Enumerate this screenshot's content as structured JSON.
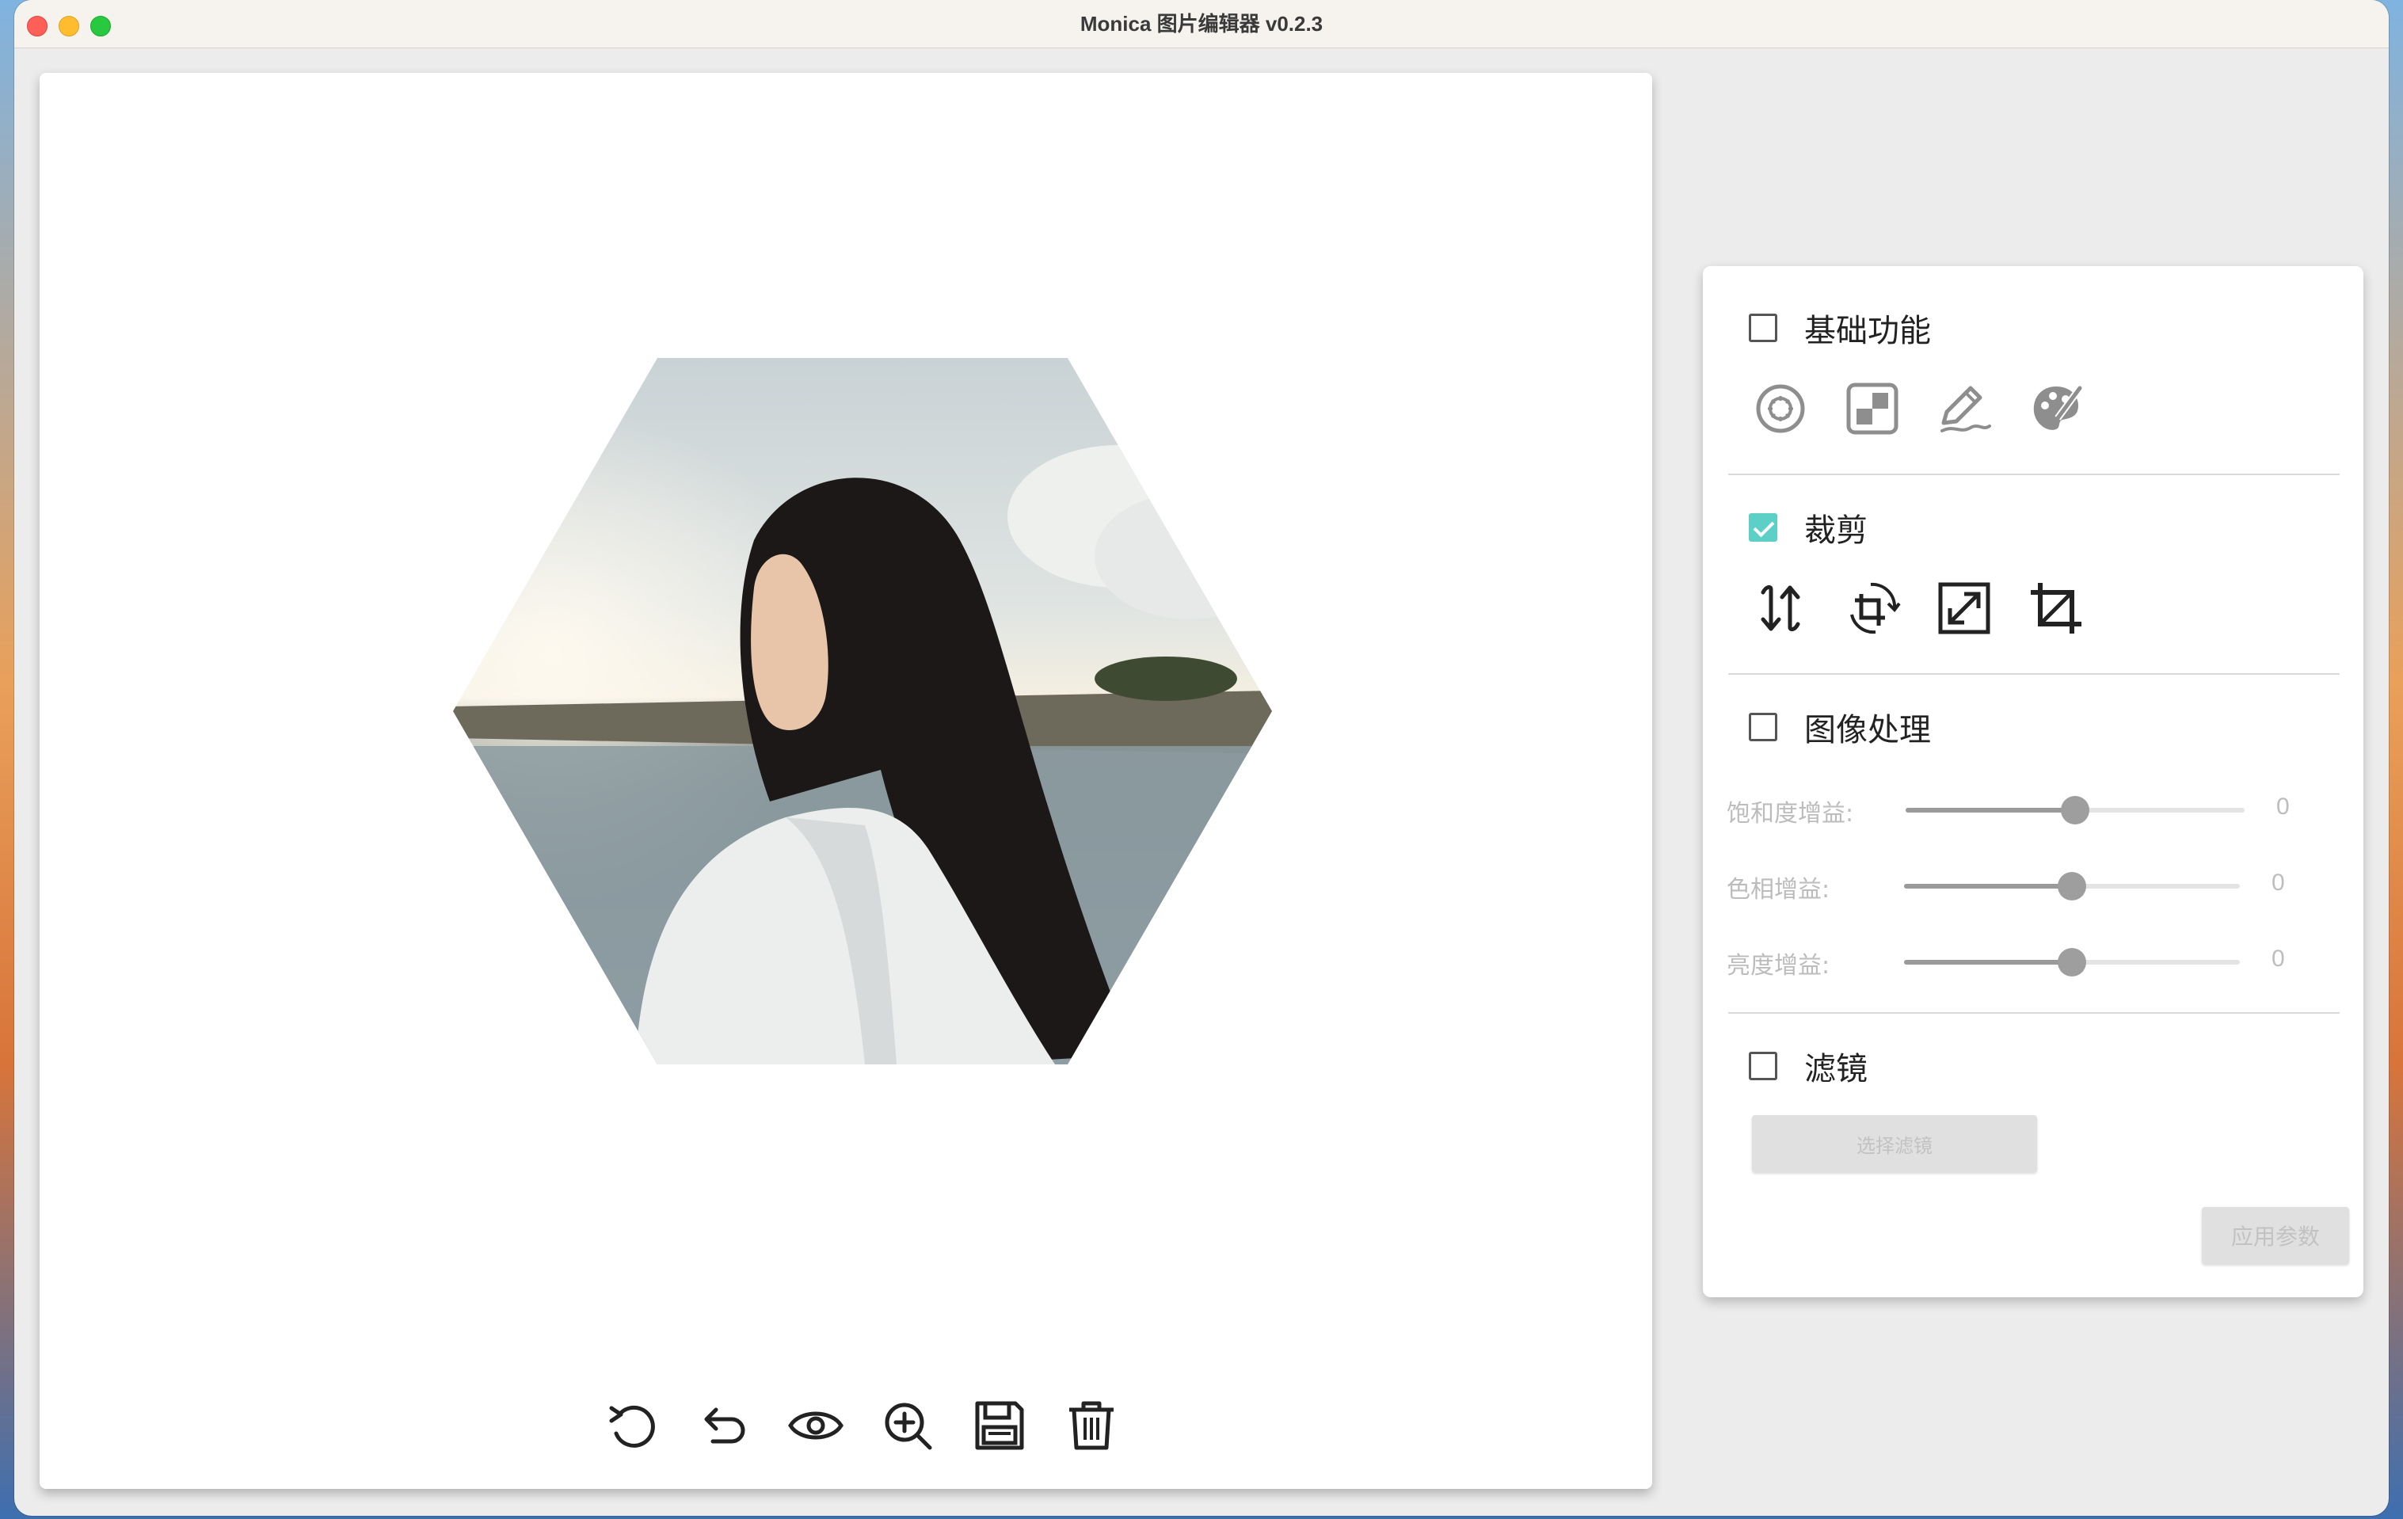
{
  "window": {
    "title": "Monica 图片编辑器 v0.2.3"
  },
  "canvas": {
    "image_alt": "hexagon-cropped portrait photo",
    "toolbar": [
      {
        "name": "rotate-reset-button",
        "icon": "rotate-ccw-icon"
      },
      {
        "name": "undo-button",
        "icon": "undo-arrow-icon"
      },
      {
        "name": "preview-button",
        "icon": "eye-icon"
      },
      {
        "name": "zoom-in-button",
        "icon": "zoom-in-icon"
      },
      {
        "name": "save-button",
        "icon": "floppy-disk-icon"
      },
      {
        "name": "delete-button",
        "icon": "trash-icon"
      }
    ]
  },
  "panel": {
    "basic": {
      "label": "基础功能",
      "checked": false,
      "icons": [
        "color-picker-icon",
        "mosaic-icon",
        "pen-draw-icon",
        "palette-icon"
      ]
    },
    "crop": {
      "label": "裁剪",
      "checked": true,
      "icons": [
        "flip-icon",
        "rotate-crop-icon",
        "resize-icon",
        "crop-icon"
      ]
    },
    "image_processing": {
      "label": "图像处理",
      "checked": false,
      "sliders": [
        {
          "label": "饱和度增益:",
          "value": "0",
          "fraction": 0.5
        },
        {
          "label": "色相增益:",
          "value": "0",
          "fraction": 0.5
        },
        {
          "label": "亮度增益:",
          "value": "0",
          "fraction": 0.5
        }
      ]
    },
    "filter": {
      "label": "滤镜",
      "checked": false,
      "select_button": "选择滤镜"
    },
    "apply_button": "应用参数"
  },
  "colors": {
    "accent": "#5cd0c6",
    "icon": "#222222",
    "icon_muted": "#8e8e8e"
  }
}
